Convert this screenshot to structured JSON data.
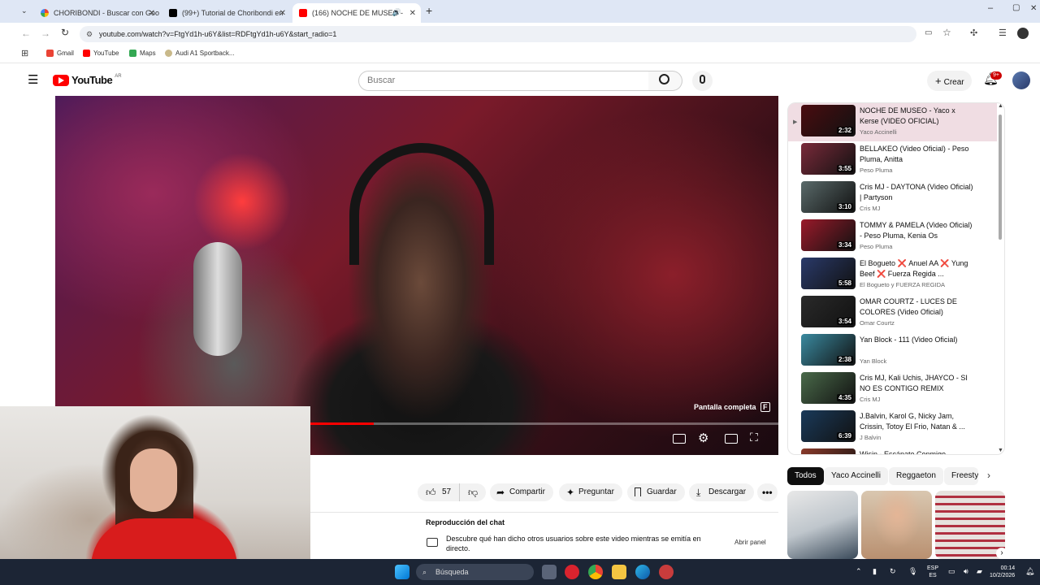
{
  "browser": {
    "tabs": [
      {
        "title": "CHORIBONDI - Buscar con Goo",
        "active": false
      },
      {
        "title": "(99+) Tutorial de Choribondi en",
        "active": false
      },
      {
        "title": "(166) NOCHE DE MUSEO -",
        "active": true
      }
    ],
    "url": "youtube.com/watch?v=FtgYd1h-u6Y&list=RDFtgYd1h-u6Y&start_radio=1",
    "bookmarks": [
      "Gmail",
      "YouTube",
      "Maps",
      "Audi A1 Sportback..."
    ]
  },
  "youtube": {
    "logo_text": "YouTube",
    "logo_country": "AR",
    "search_placeholder": "Buscar",
    "create_label": "Crear",
    "notifications_badge": "9+"
  },
  "player": {
    "fullscreen_tooltip": "Pantalla completa",
    "fullscreen_key": "F",
    "progress": 0.44
  },
  "actions": {
    "likes": "57",
    "share": "Compartir",
    "ask": "Preguntar",
    "save": "Guardar",
    "download": "Descargar"
  },
  "chat_replay": {
    "title": "Reproducción del chat",
    "description": "Descubre qué han dicho otros usuarios sobre este video mientras se emitía en directo.",
    "open_label": "Abrir panel"
  },
  "playlist": [
    {
      "title": "NOCHE DE MUSEO - Yaco x Kerse (VIDEO OFICIAL)",
      "channel": "Yaco Accinelli",
      "duration": "2:32",
      "current": true,
      "color": "#4a0c10"
    },
    {
      "title": "BELLAKEO (Video Oficial) - Peso Pluma, Anitta",
      "channel": "Peso Pluma",
      "duration": "3:55",
      "current": false,
      "color": "#7a2a3a"
    },
    {
      "title": "Cris MJ - DAYTONA (Video Oficial) | Partyson",
      "channel": "Cris MJ",
      "duration": "3:10",
      "current": false,
      "color": "#5a6a6a"
    },
    {
      "title": "TOMMY & PAMELA (Video Oficial) - Peso Pluma, Kenia Os",
      "channel": "Peso Pluma",
      "duration": "3:34",
      "current": false,
      "color": "#9a1a2a"
    },
    {
      "title": "El Boguetо ❌ Anuel AA ❌ Yung Beef ❌ Fuerza Regida ...",
      "channel": "El Boguetо y FUERZA REGIDA",
      "duration": "5:58",
      "current": false,
      "color": "#2a3a6a"
    },
    {
      "title": "OMAR COURTZ - LUCES DE COLORES (Video Oficial)",
      "channel": "Omar Courtz",
      "duration": "3:54",
      "current": false,
      "color": "#2a2a2a"
    },
    {
      "title": "Yan Block - 111 (Video Oficial)",
      "channel": "Yan Block",
      "duration": "2:38",
      "current": false,
      "color": "#3a8aa0"
    },
    {
      "title": "Cris MJ, Kali Uchis, JHAYCO - SI NO ES CONTIGO REMIX",
      "channel": "Cris MJ",
      "duration": "4:35",
      "current": false,
      "color": "#4a6a4a"
    },
    {
      "title": "J.Balvin, Karol G, Nicky Jam, Crissin, Totoy El Frio, Natan & ...",
      "channel": "J Balvin",
      "duration": "6:39",
      "current": false,
      "color": "#1a3a5a"
    },
    {
      "title": "Wisin - Escápate Conmigo",
      "channel": "",
      "duration": "",
      "current": false,
      "color": "#8a3a2a"
    }
  ],
  "chips": [
    "Todos",
    "Yaco Accinelli",
    "Reggaeton",
    "Freesty"
  ],
  "taskbar": {
    "search_placeholder": "Búsqueda",
    "lang_top": "ESP",
    "lang_bottom": "ES",
    "time": "00:14",
    "date": "10/2/2026"
  }
}
